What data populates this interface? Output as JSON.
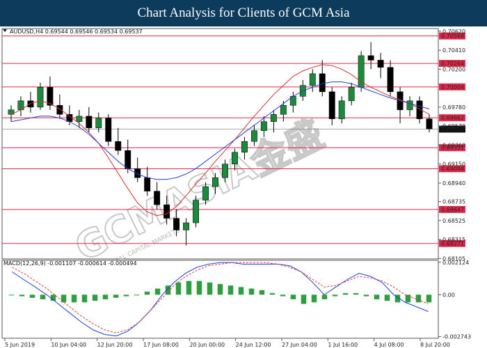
{
  "header": {
    "title": "Chart Analysis for Clients of GCM Asia"
  },
  "price_panel": {
    "label": "AUDUSD,H4 0.69544 0.69546 0.69534 0.69537"
  },
  "macd_panel": {
    "label": "MACD(12,26,9) -0.001107 -0.000614 -0.000494"
  },
  "watermark": {
    "main": "GCMASIA金盛",
    "sub": "GLOBAL CAPITAL MARKETS"
  },
  "colors": {
    "hline": "#e0294a",
    "candle": "#1b8a3c",
    "ma_fast": "#d32f2f",
    "ma_slow": "#1e3fd6",
    "macd_hist": "#2e9e3e",
    "macd_line": "#1e3fd6",
    "signal_line": "#e53935",
    "current_price": "#111111"
  },
  "chart_data": [
    {
      "type": "line",
      "title": "AUDUSD,H4",
      "ylim": [
        0.681,
        0.7065
      ],
      "price_ticks": [
        "0.70620",
        "0.70410",
        "0.70200",
        "0.69780",
        "0.69570",
        "0.69360",
        "0.69150",
        "0.68940",
        "0.68735",
        "0.68525",
        "0.68315",
        "0.68105"
      ],
      "levels": [
        "0.70568",
        "0.70264",
        "0.70004",
        "0.69662",
        "0.69331",
        "0.69098",
        "0.68647",
        "0.68271"
      ],
      "current_price": "0.69537",
      "x_labels": [
        "5 Jun 2019",
        "10 Jun 04:00",
        "12 Jun 20:00",
        "17 Jun 08:00",
        "20 Jun 00:00",
        "24 Jun 12:00",
        "27 Jun 04:00",
        "1 Jul 16:00",
        "4 Jul 08:00",
        "8 Jul 20:00"
      ],
      "candles": [
        [
          0.697,
          0.698,
          0.6962,
          0.6975
        ],
        [
          0.6975,
          0.699,
          0.6968,
          0.6985
        ],
        [
          0.6985,
          0.6995,
          0.6972,
          0.6978
        ],
        [
          0.6978,
          0.7005,
          0.6975,
          0.7
        ],
        [
          0.7,
          0.7012,
          0.6975,
          0.698
        ],
        [
          0.698,
          0.6992,
          0.6965,
          0.697
        ],
        [
          0.697,
          0.698,
          0.6958,
          0.6962
        ],
        [
          0.6962,
          0.6975,
          0.6955,
          0.6968
        ],
        [
          0.6968,
          0.6978,
          0.695,
          0.6955
        ],
        [
          0.6955,
          0.6972,
          0.695,
          0.6966
        ],
        [
          0.6966,
          0.697,
          0.6935,
          0.694
        ],
        [
          0.694,
          0.6955,
          0.6925,
          0.693
        ],
        [
          0.693,
          0.6942,
          0.6905,
          0.691
        ],
        [
          0.691,
          0.6922,
          0.6895,
          0.69
        ],
        [
          0.69,
          0.6912,
          0.688,
          0.6885
        ],
        [
          0.6885,
          0.6895,
          0.6865,
          0.687
        ],
        [
          0.687,
          0.688,
          0.6848,
          0.6855
        ],
        [
          0.6855,
          0.6865,
          0.6835,
          0.6842
        ],
        [
          0.6842,
          0.6855,
          0.6825,
          0.685
        ],
        [
          0.685,
          0.688,
          0.6845,
          0.6875
        ],
        [
          0.6875,
          0.6895,
          0.687,
          0.689
        ],
        [
          0.689,
          0.6905,
          0.6882,
          0.69
        ],
        [
          0.69,
          0.692,
          0.6895,
          0.6915
        ],
        [
          0.6915,
          0.6932,
          0.6908,
          0.6928
        ],
        [
          0.6928,
          0.6945,
          0.692,
          0.694
        ],
        [
          0.694,
          0.6958,
          0.6935,
          0.6952
        ],
        [
          0.6952,
          0.6968,
          0.6945,
          0.6962
        ],
        [
          0.6962,
          0.6975,
          0.695,
          0.697
        ],
        [
          0.697,
          0.6985,
          0.6962,
          0.698
        ],
        [
          0.698,
          0.6995,
          0.6972,
          0.699
        ],
        [
          0.699,
          0.7008,
          0.6985,
          0.7002
        ],
        [
          0.7002,
          0.702,
          0.6995,
          0.7015
        ],
        [
          0.7015,
          0.703,
          0.699,
          0.6995
        ],
        [
          0.6995,
          0.7,
          0.6958,
          0.6965
        ],
        [
          0.6965,
          0.699,
          0.696,
          0.6985
        ],
        [
          0.6985,
          0.7005,
          0.698,
          0.7
        ],
        [
          0.7,
          0.704,
          0.6995,
          0.7035
        ],
        [
          0.7035,
          0.705,
          0.702,
          0.703
        ],
        [
          0.703,
          0.7038,
          0.701,
          0.7022
        ],
        [
          0.7022,
          0.703,
          0.699,
          0.6995
        ],
        [
          0.6995,
          0.7,
          0.696,
          0.6975
        ],
        [
          0.6975,
          0.699,
          0.6968,
          0.6985
        ],
        [
          0.6985,
          0.699,
          0.696,
          0.6965
        ],
        [
          0.6965,
          0.697,
          0.695,
          0.6954
        ]
      ],
      "ma_fast": [
        0.697,
        0.6975,
        0.6982,
        0.6985,
        0.6982,
        0.6976,
        0.6968,
        0.696,
        0.695,
        0.6938,
        0.6922,
        0.6905,
        0.6888,
        0.6872,
        0.6862,
        0.6858,
        0.686,
        0.6868,
        0.688,
        0.6893,
        0.6905,
        0.6918,
        0.693,
        0.6942,
        0.6955,
        0.6968,
        0.698,
        0.6992,
        0.7002,
        0.7012,
        0.7018,
        0.7022,
        0.7025,
        0.7024,
        0.702,
        0.7014,
        0.7006,
        0.7,
        0.6995,
        0.699,
        0.6986,
        0.6982,
        0.6976,
        0.697
      ],
      "ma_slow": [
        0.6962,
        0.6964,
        0.6966,
        0.6968,
        0.6968,
        0.6966,
        0.6962,
        0.6956,
        0.6948,
        0.6938,
        0.6928,
        0.6918,
        0.691,
        0.6904,
        0.69,
        0.6898,
        0.6898,
        0.69,
        0.6904,
        0.691,
        0.6918,
        0.6926,
        0.6934,
        0.6942,
        0.695,
        0.6958,
        0.6966,
        0.6974,
        0.6982,
        0.699,
        0.6996,
        0.7,
        0.7004,
        0.7006,
        0.7006,
        0.7004,
        0.7,
        0.6996,
        0.6992,
        0.6988,
        0.6985,
        0.6982,
        0.6979,
        0.6976
      ]
    },
    {
      "type": "bar",
      "title": "MACD(12,26,9)",
      "ylim": [
        -0.00285,
        0.00225
      ],
      "macd_ticks": [
        "0.002124",
        "0.00",
        "-0.002743"
      ],
      "histogram": [
        0.0,
        -0.0001,
        -0.0002,
        -0.0003,
        -0.0004,
        -0.0005,
        -0.0005,
        -0.0005,
        -0.0004,
        -0.0003,
        -0.0002,
        -0.0001,
        0.0,
        0.0002,
        0.0004,
        0.0006,
        0.0008,
        0.0009,
        0.0009,
        0.0008,
        0.0007,
        0.0006,
        0.0005,
        0.0004,
        0.0003,
        0.0001,
        -0.0001,
        -0.0003,
        -0.0006,
        -0.0005,
        -0.0003,
        -0.0001,
        0.0001,
        0.0001,
        -0.0001,
        -0.0003,
        -0.0004,
        -0.0005,
        -0.0005,
        -0.0005,
        -0.0005
      ],
      "macd": [
        0.0015,
        0.001,
        0.0005,
        0.0,
        -0.0006,
        -0.0012,
        -0.0018,
        -0.0023,
        -0.0026,
        -0.0027,
        -0.0024,
        -0.0018,
        -0.001,
        0.0,
        0.0008,
        0.0014,
        0.0018,
        0.002,
        0.0021,
        0.0021,
        0.002,
        0.002,
        0.002,
        0.002,
        0.0019,
        0.0015,
        0.0008,
        0.0,
        0.0005,
        0.001,
        0.0014,
        0.0012,
        0.0008,
        0.0,
        -0.0005,
        -0.0008,
        -0.0011
      ],
      "signal": [
        0.0018,
        0.0014,
        0.0009,
        0.0004,
        -0.0002,
        -0.0008,
        -0.0014,
        -0.0019,
        -0.0023,
        -0.0025,
        -0.0023,
        -0.0018,
        -0.001,
        -0.0002,
        0.0006,
        0.0012,
        0.0016,
        0.0019,
        0.002,
        0.0021,
        0.0021,
        0.0021,
        0.0021,
        0.002,
        0.0018,
        0.0015,
        0.001,
        0.0005,
        0.0006,
        0.0009,
        0.0012,
        0.0011,
        0.0009,
        0.0005,
        0.0,
        -0.0003,
        -0.0006
      ]
    }
  ]
}
